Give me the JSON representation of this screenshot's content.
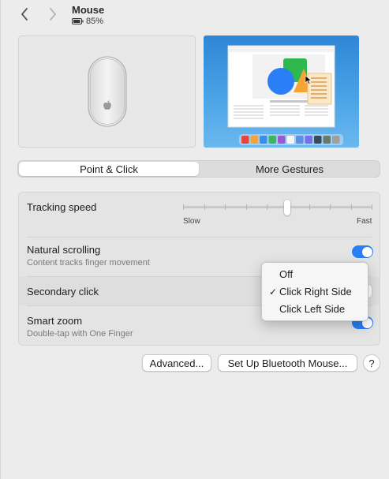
{
  "header": {
    "title": "Mouse",
    "battery": "85%"
  },
  "tabs": [
    {
      "label": "Point & Click",
      "active": true
    },
    {
      "label": "More Gestures",
      "active": false
    }
  ],
  "tracking": {
    "label": "Tracking speed",
    "slow_label": "Slow",
    "fast_label": "Fast",
    "value_fraction": 0.55
  },
  "natural_scrolling": {
    "label": "Natural scrolling",
    "subtitle": "Content tracks finger movement",
    "enabled": true
  },
  "secondary_click": {
    "label": "Secondary click"
  },
  "smart_zoom": {
    "label": "Smart zoom",
    "subtitle": "Double-tap with One Finger",
    "enabled": true
  },
  "menu": {
    "items": [
      {
        "label": "Off",
        "checked": false
      },
      {
        "label": "Click Right Side",
        "checked": true
      },
      {
        "label": "Click Left Side",
        "checked": false
      }
    ],
    "check_glyph": "✓"
  },
  "buttons": {
    "advanced": "Advanced...",
    "bluetooth": "Set Up Bluetooth Mouse...",
    "help": "?"
  },
  "colors": {
    "accent": "#2a7ff6",
    "dock_icons": [
      "#e8453c",
      "#f3a33b",
      "#3a8fe8",
      "#3cb85a",
      "#9b59d0",
      "#f5f5f5",
      "#5b8fe6",
      "#7b6ce8",
      "#3a4a5a",
      "#6a7a6a",
      "#a0a0a0"
    ]
  }
}
